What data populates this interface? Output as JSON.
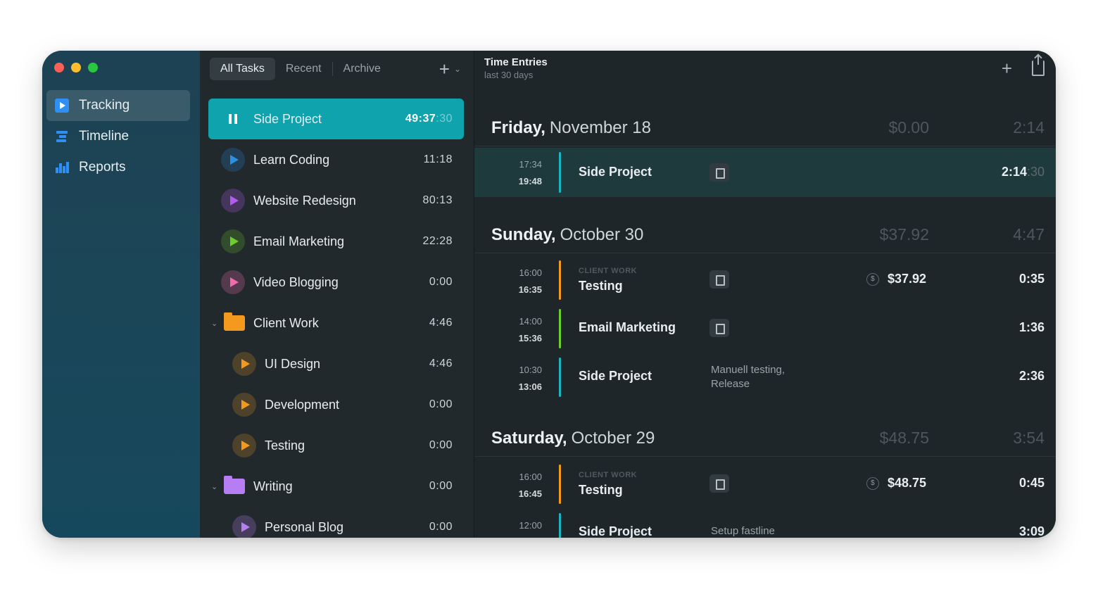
{
  "sidebar": {
    "items": [
      {
        "label": "Tracking",
        "icon": "tracking-icon",
        "active": true
      },
      {
        "label": "Timeline",
        "icon": "timeline-icon"
      },
      {
        "label": "Reports",
        "icon": "reports-icon"
      }
    ]
  },
  "tasks": {
    "tabs": [
      "All Tasks",
      "Recent",
      "Archive"
    ],
    "add_label": "+",
    "dropdown_label": "⌄",
    "items": [
      {
        "name": "Side Project",
        "time": "49:37",
        "seconds": ":30",
        "state": "running"
      },
      {
        "name": "Learn Coding",
        "time": "11:18",
        "color": "#2b8fe6"
      },
      {
        "name": "Website Redesign",
        "time": "80:13",
        "color": "#b35bf0"
      },
      {
        "name": "Email Marketing",
        "time": "22:28",
        "color": "#6ccf2b"
      },
      {
        "name": "Video Blogging",
        "time": "0:00",
        "color": "#f06ab0"
      },
      {
        "name": "Client Work",
        "time": "4:46",
        "folder": true,
        "color": "#f39a1e"
      },
      {
        "name": "UI Design",
        "time": "4:46",
        "color": "#f39a1e"
      },
      {
        "name": "Development",
        "time": "0:00",
        "color": "#f39a1e"
      },
      {
        "name": "Testing",
        "time": "0:00",
        "color": "#f39a1e"
      },
      {
        "name": "Writing",
        "time": "0:00",
        "folder": true,
        "color": "#b67ef2"
      },
      {
        "name": "Personal Blog",
        "time": "0:00",
        "color": "#b67ef2"
      }
    ]
  },
  "entries": {
    "title": "Time Entries",
    "subtitle": "last 30 days",
    "add_label": "+",
    "days": [
      {
        "name": "Friday,",
        "date": "November 18",
        "amount": "$0.00",
        "total": "2:14",
        "items": [
          {
            "start": "17:34",
            "end": "19:48",
            "project": "Side Project",
            "bar": "#19b6c2",
            "doc": true,
            "duration": "2:14",
            "seconds": ":30",
            "selected": true
          }
        ]
      },
      {
        "name": "Sunday,",
        "date": "October 30",
        "amount": "$37.92",
        "total": "4:47",
        "items": [
          {
            "start": "16:00",
            "end": "16:35",
            "client": "CLIENT WORK",
            "project": "Testing",
            "bar": "#f39a1e",
            "doc": true,
            "money": "$37.92",
            "coin": "$",
            "duration": "0:35"
          },
          {
            "start": "14:00",
            "end": "15:36",
            "project": "Email Marketing",
            "bar": "#6ccf2b",
            "doc": true,
            "duration": "1:36"
          },
          {
            "start": "10:30",
            "end": "13:06",
            "project": "Side Project",
            "bar": "#19b6c2",
            "note": "Manuell testing, Release",
            "duration": "2:36"
          }
        ]
      },
      {
        "name": "Saturday,",
        "date": "October 29",
        "amount": "$48.75",
        "total": "3:54",
        "items": [
          {
            "start": "16:00",
            "end": "16:45",
            "client": "CLIENT WORK",
            "project": "Testing",
            "bar": "#f39a1e",
            "doc": true,
            "money": "$48.75",
            "coin": "$",
            "duration": "0:45"
          },
          {
            "start": "12:00",
            "end": "",
            "project": "Side Project",
            "bar": "#19b6c2",
            "note": "Setup fastline",
            "duration": "3:09"
          }
        ]
      }
    ]
  }
}
